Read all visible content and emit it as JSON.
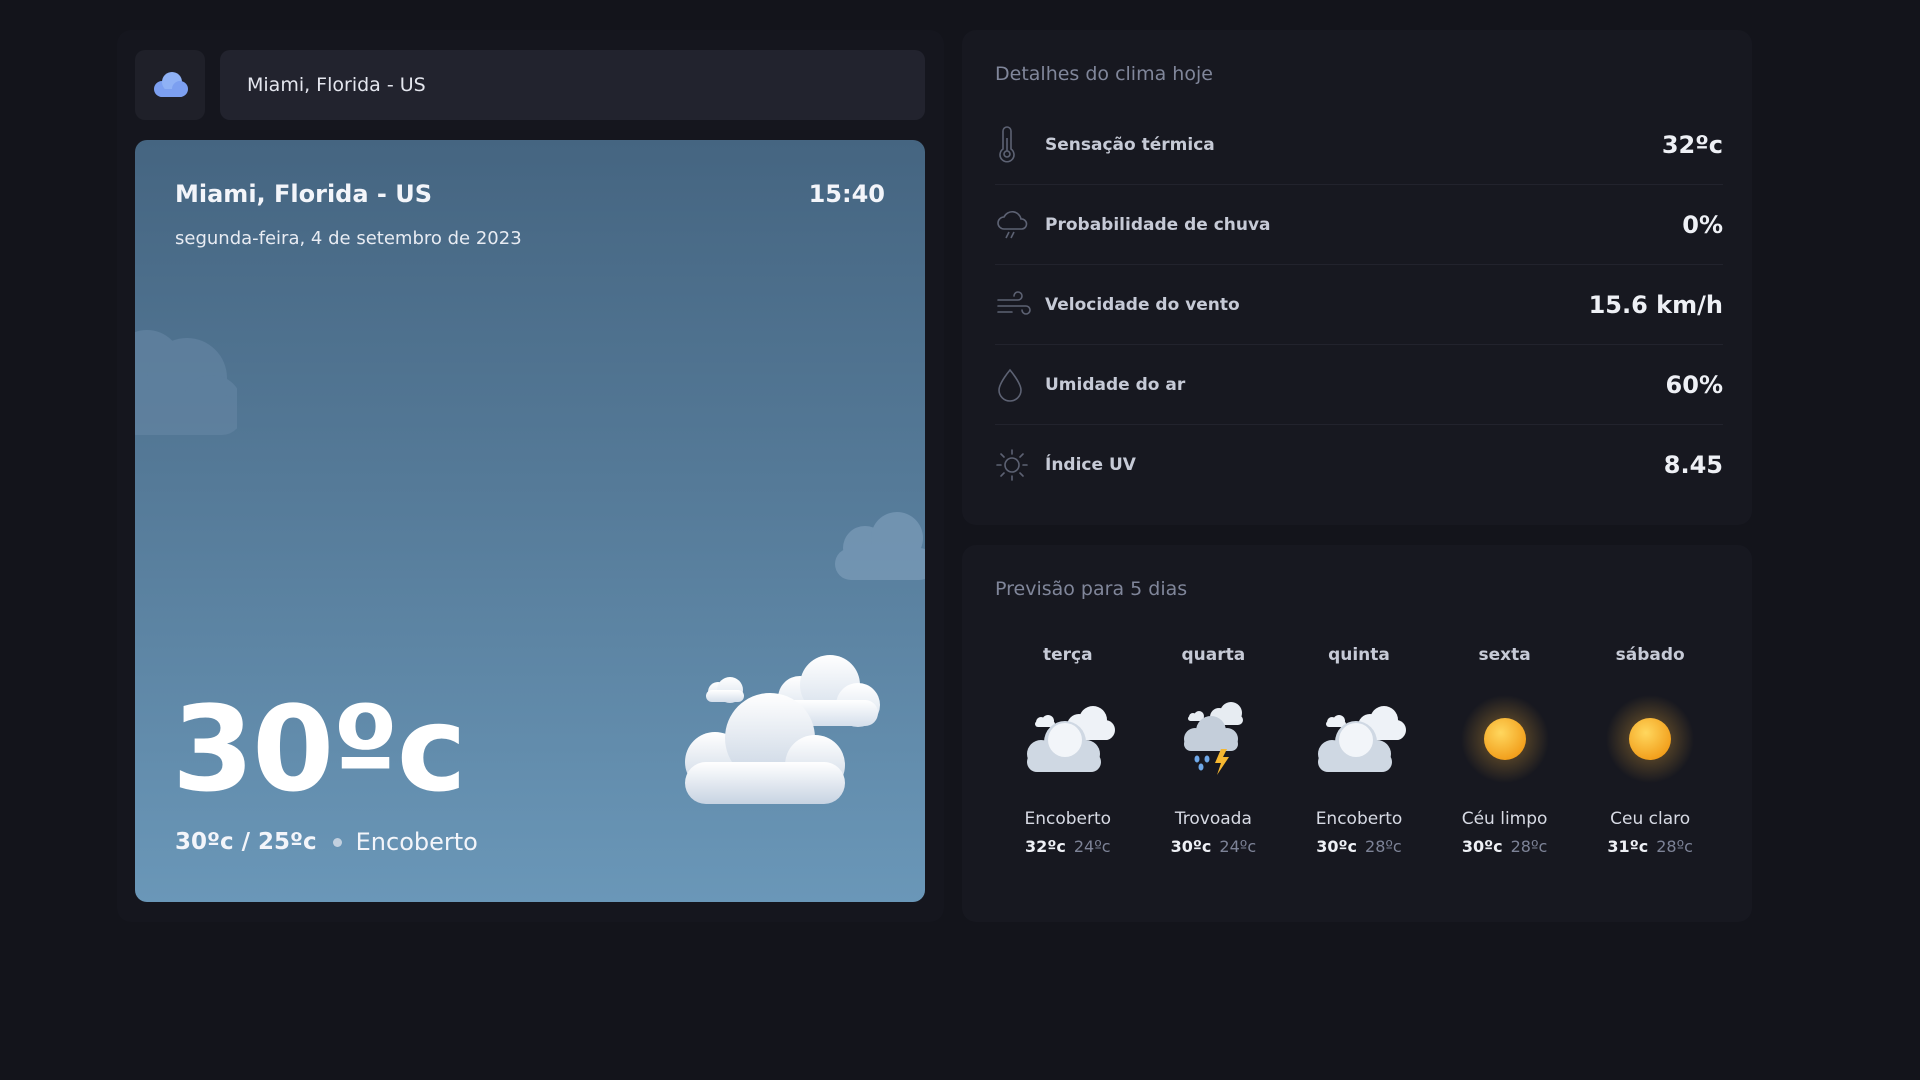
{
  "search": {
    "value": "Miami, Florida - US",
    "logo_icon": "clouds-logo-icon"
  },
  "today": {
    "city": "Miami, Florida - US",
    "time": "15:40",
    "date": "segunda-feira, 4 de setembro de 2023",
    "temp": "30ºc",
    "range": "30ºc / 25ºc",
    "condition": "Encoberto",
    "icon": "cloudy-icon"
  },
  "details": {
    "title": "Detalhes do clima hoje",
    "rows": [
      {
        "label": "Sensação térmica",
        "value": "32ºc",
        "icon": "thermometer-icon"
      },
      {
        "label": "Probabilidade de chuva",
        "value": "0%",
        "icon": "cloud-rain-icon"
      },
      {
        "label": "Velocidade do vento",
        "value": "15.6 km/h",
        "icon": "wind-icon"
      },
      {
        "label": "Umidade do ar",
        "value": "60%",
        "icon": "droplet-icon"
      },
      {
        "label": "Índice UV",
        "value": "8.45",
        "icon": "sun-icon"
      }
    ]
  },
  "forecast": {
    "title": "Previsão para 5 dias",
    "days": [
      {
        "name": "terça",
        "condition": "Encoberto",
        "max": "32ºc",
        "min": "24ºc",
        "icon": "cloudy-icon"
      },
      {
        "name": "quarta",
        "condition": "Trovoada",
        "max": "30ºc",
        "min": "24ºc",
        "icon": "thunderstorm-icon"
      },
      {
        "name": "quinta",
        "condition": "Encoberto",
        "max": "30ºc",
        "min": "28ºc",
        "icon": "cloudy-icon"
      },
      {
        "name": "sexta",
        "condition": "Céu limpo",
        "max": "30ºc",
        "min": "28ºc",
        "icon": "sun-icon"
      },
      {
        "name": "sábado",
        "condition": "Ceu claro",
        "max": "31ºc",
        "min": "28ºc",
        "icon": "sun-icon"
      }
    ]
  },
  "colors": {
    "background": "#13141b",
    "panel": "#171820",
    "card_top": "#456581",
    "card_bottom": "#6a97b8",
    "accent": "#8fb1f5",
    "muted_text": "#80869a"
  }
}
